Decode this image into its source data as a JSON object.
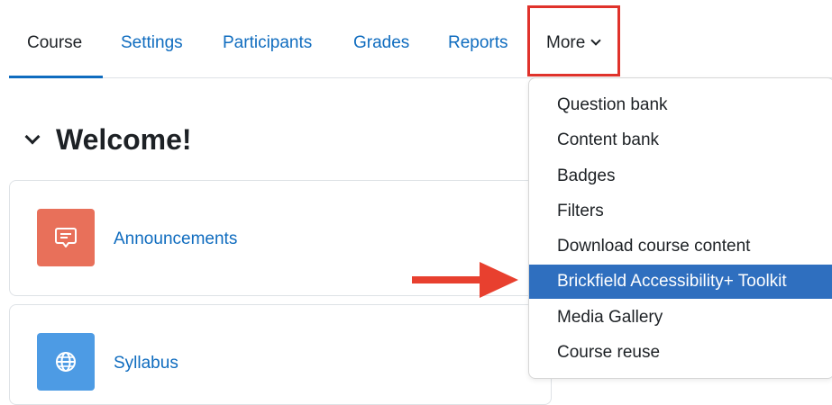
{
  "tabs": [
    {
      "label": "Course",
      "active": true
    },
    {
      "label": "Settings",
      "active": false
    },
    {
      "label": "Participants",
      "active": false
    },
    {
      "label": "Grades",
      "active": false
    },
    {
      "label": "Reports",
      "active": false
    },
    {
      "label": "More",
      "active": false
    }
  ],
  "section": {
    "title": "Welcome!"
  },
  "activities": [
    {
      "label": "Announcements",
      "icon": "forum-icon",
      "color": "#e8705a"
    },
    {
      "label": "Syllabus",
      "icon": "globe-icon",
      "color": "#4d9be4"
    }
  ],
  "more_menu": {
    "items": [
      {
        "label": "Question bank"
      },
      {
        "label": "Content bank"
      },
      {
        "label": "Badges"
      },
      {
        "label": "Filters"
      },
      {
        "label": "Download course content"
      },
      {
        "label": "Brickfield Accessibility+ Toolkit",
        "selected": true
      },
      {
        "label": "Media Gallery"
      },
      {
        "label": "Course reuse"
      }
    ]
  },
  "colors": {
    "link": "#0f6cbf",
    "highlight_box": "#e0322b",
    "arrow": "#e8402f",
    "selected": "#2f6fbf"
  }
}
